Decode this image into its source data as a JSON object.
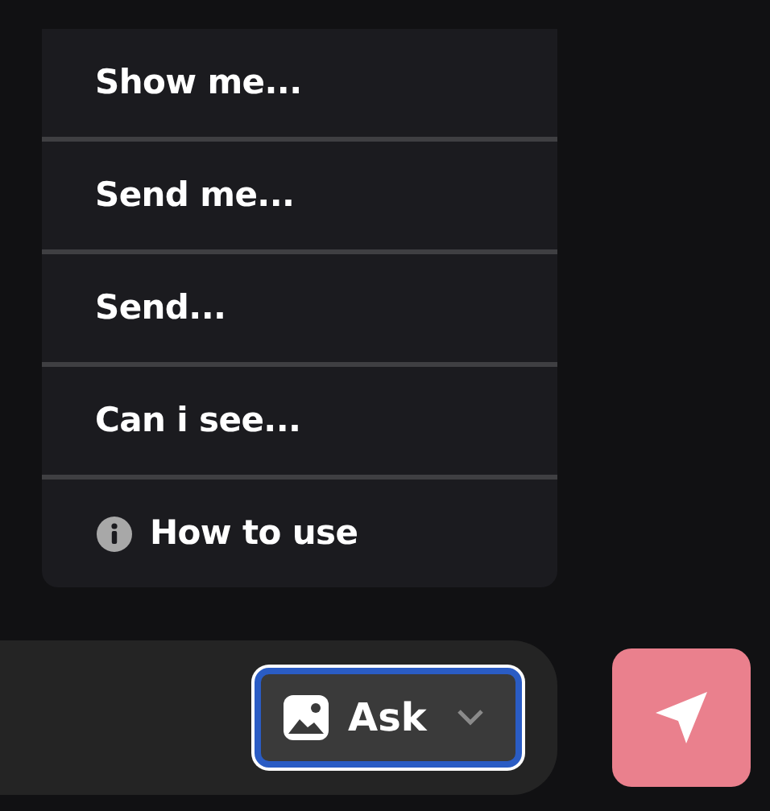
{
  "menu": {
    "items": [
      {
        "kind": "suggestion",
        "label": "Show me..."
      },
      {
        "kind": "suggestion",
        "label": "Send me..."
      },
      {
        "kind": "suggestion",
        "label": "Send..."
      },
      {
        "kind": "suggestion",
        "label": "Can i see..."
      },
      {
        "kind": "info",
        "label": "How to use"
      }
    ]
  },
  "composer": {
    "mode_button": {
      "label": "Ask",
      "focused": true
    }
  }
}
